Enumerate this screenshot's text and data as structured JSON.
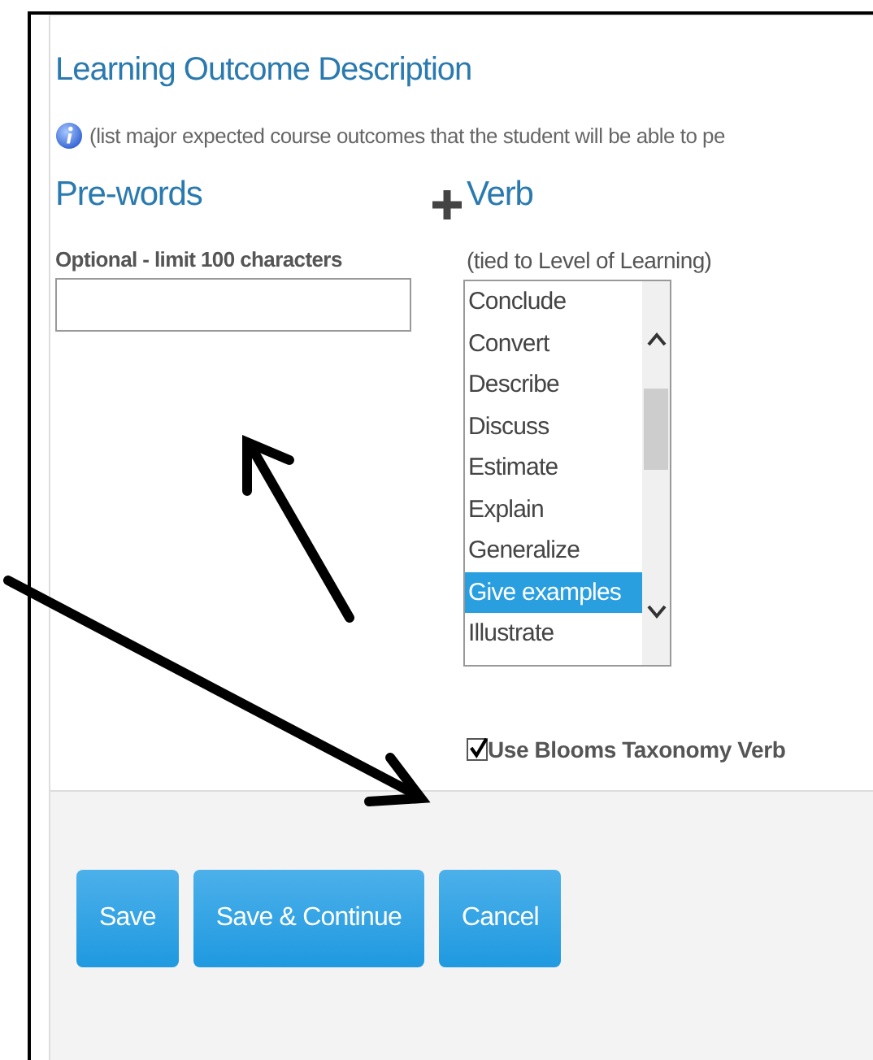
{
  "title": "Learning Outcome Description",
  "hint": "(list major expected course outcomes that the student will be able to pe",
  "prewords": {
    "heading": "Pre-words",
    "label": "Optional - limit 100 characters"
  },
  "verb": {
    "heading": "Verb",
    "label": "(tied to Level of Learning)",
    "options": [
      {
        "label": "Conclude",
        "selected": false
      },
      {
        "label": "Convert",
        "selected": false
      },
      {
        "label": "Describe",
        "selected": false
      },
      {
        "label": "Discuss",
        "selected": false
      },
      {
        "label": "Estimate",
        "selected": false
      },
      {
        "label": "Explain",
        "selected": false
      },
      {
        "label": "Generalize",
        "selected": false
      },
      {
        "label": "Give examples",
        "selected": true
      },
      {
        "label": "Illustrate",
        "selected": false
      }
    ]
  },
  "bloom_checkbox": {
    "label": "Use Blooms Taxonomy Verb",
    "checked": true
  },
  "buttons": [
    "Save",
    "Save & Continue",
    "Cancel"
  ]
}
